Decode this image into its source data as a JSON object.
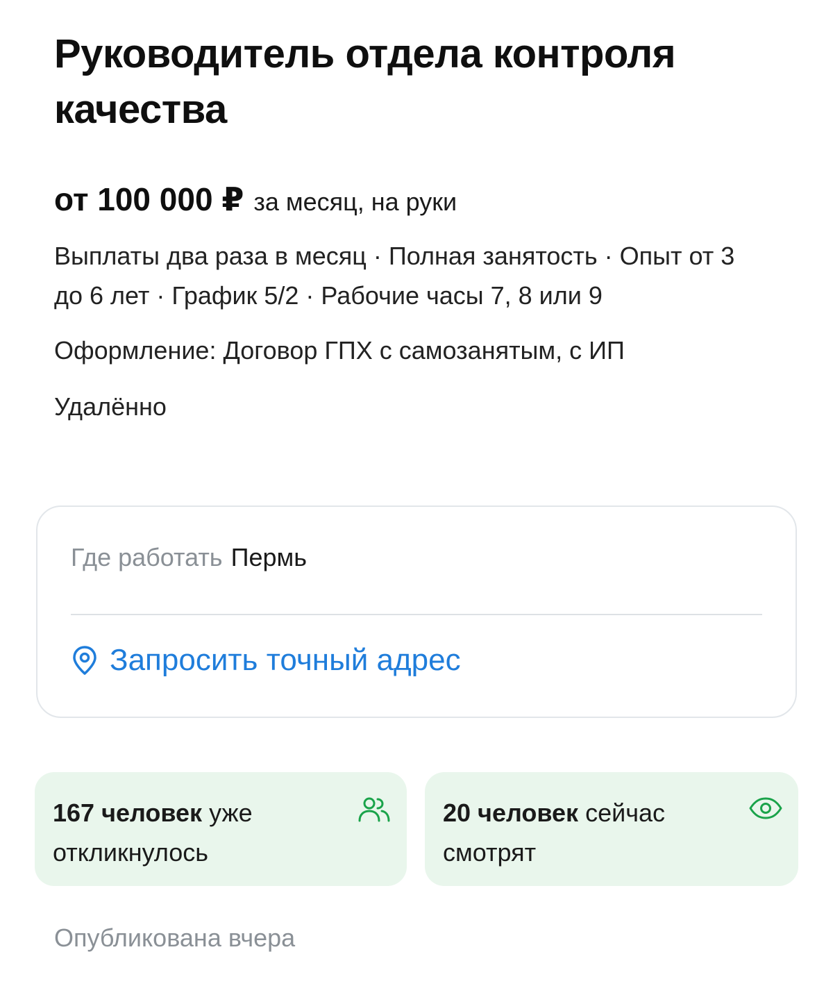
{
  "vacancy": {
    "title": "Руководитель отдела контроля качества",
    "salary": {
      "amount": "от 100 000 ₽",
      "note": "за месяц, на руки"
    },
    "meta": "Выплаты два раза в месяц · Полная занятость · Опыт от 3 до 6 лет · График 5/2 · Рабочие часы 7, 8 или 9",
    "employment": "Оформление: Договор ГПХ с самозанятым, с ИП",
    "work_format": "Удалённо"
  },
  "location": {
    "label": "Где работать",
    "city": "Пермь",
    "address_link": "Запросить точный адрес",
    "icon": "location-pin-icon"
  },
  "stats": {
    "responded": {
      "count": "167 человек",
      "text": "уже откликнулось",
      "icon": "people-icon"
    },
    "viewing": {
      "count": "20 человек",
      "text": "сейчас смотрят",
      "icon": "eye-icon"
    }
  },
  "published": "Опубликована вчера",
  "colors": {
    "accent_link": "#1f7ddb",
    "stat_bg": "#e9f6ec",
    "stat_icon": "#1aa34a",
    "muted_text": "#8a9096"
  }
}
